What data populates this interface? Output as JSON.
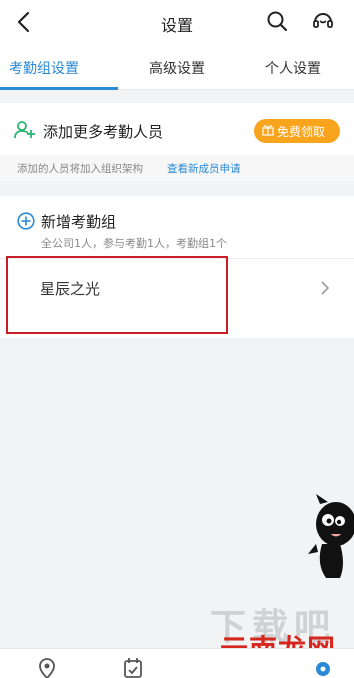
{
  "header": {
    "title": "设置"
  },
  "tabs": [
    {
      "label": "考勤组设置",
      "active": true
    },
    {
      "label": "高级设置",
      "active": false
    },
    {
      "label": "个人设置",
      "active": false
    }
  ],
  "add_people": {
    "label": "添加更多考勤人员",
    "button_label": "免费领取",
    "hint": "添加的人员将加入组织架构",
    "hint_link": "查看新成员申请"
  },
  "add_group": {
    "label": "新增考勤组",
    "summary": "全公司1人，参与考勤1人，考勤组1个"
  },
  "groups": [
    {
      "name": "星辰之光"
    }
  ],
  "watermark": "云南龙网",
  "colors": {
    "accent": "#2a8ad6",
    "button": "#f8a41d",
    "highlight": "#c81e28"
  },
  "icons": [
    "back-arrow-icon",
    "search-icon",
    "support-headset-icon",
    "add-person-icon",
    "gift-icon",
    "add-circle-icon",
    "chevron-right-icon",
    "location-pin-icon",
    "calendar-check-icon",
    "settings-gear-icon"
  ]
}
